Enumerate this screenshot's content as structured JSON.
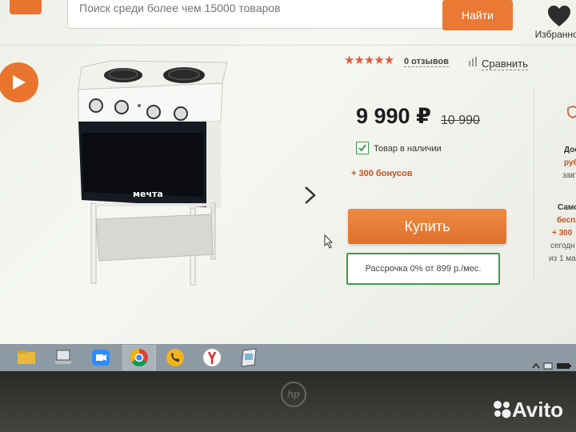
{
  "search": {
    "placeholder": "Поиск среди более чем 15000 товаров",
    "button_label": "Найти"
  },
  "header": {
    "favorites_label": "Избранное"
  },
  "product": {
    "rating_stars": "★★★★★",
    "reviews_label": "0 отзывов",
    "compare_label": "Сравнить",
    "brand_label": "мечта",
    "price": "9 990 ₽",
    "old_price": "10 990",
    "in_stock_label": "Товар в наличии",
    "bonus_label": "+ 300 бонусов",
    "buy_label": "Купить",
    "installment_label": "Рассрочка 0% от 899 р./мес."
  },
  "side_panel_fragments": [
    "Дос",
    "руб",
    "завт",
    "Само",
    "беспл",
    "+ 300",
    "сегодн",
    "из 1 ма"
  ],
  "watermark": {
    "text": "Avito"
  },
  "colors": {
    "accent_orange": "#e8742e",
    "green": "#3e9a4b",
    "star_red": "#e55a35",
    "bonus_orange": "#c2511f"
  },
  "taskbar": {
    "icons": [
      "folder-icon",
      "network-icon",
      "zoom-icon",
      "chrome-icon",
      "phone-icon",
      "yandex-browser-icon",
      "notes-icon"
    ]
  },
  "tray": {
    "icons": [
      "up-arrow-icon",
      "network-tray-icon",
      "battery-icon"
    ]
  }
}
